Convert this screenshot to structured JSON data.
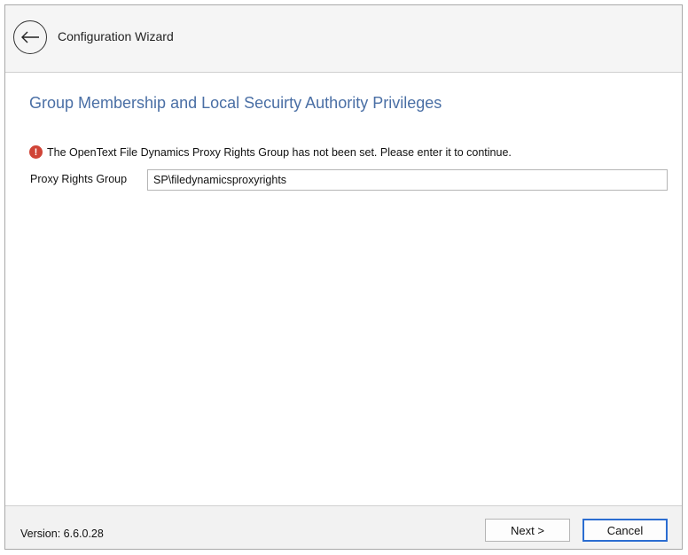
{
  "header": {
    "title": "Configuration Wizard"
  },
  "page": {
    "heading": "Group Membership and Local Secuirty Authority Privileges",
    "error_message": "The OpenText File Dynamics Proxy Rights Group has not been set. Please enter it to continue.",
    "error_icon_glyph": "!",
    "field_label": "Proxy Rights Group",
    "field_value": "SP\\filedynamicsproxyrights"
  },
  "footer": {
    "version": "Version: 6.6.0.28",
    "next_label": "Next >",
    "cancel_label": "Cancel"
  },
  "colors": {
    "heading": "#4a6fa5",
    "error": "#d04437",
    "default_button_border": "#2b6dd1"
  },
  "icons": {
    "back": "arrow-left-circle-icon",
    "error": "exclamation-circle-icon"
  }
}
